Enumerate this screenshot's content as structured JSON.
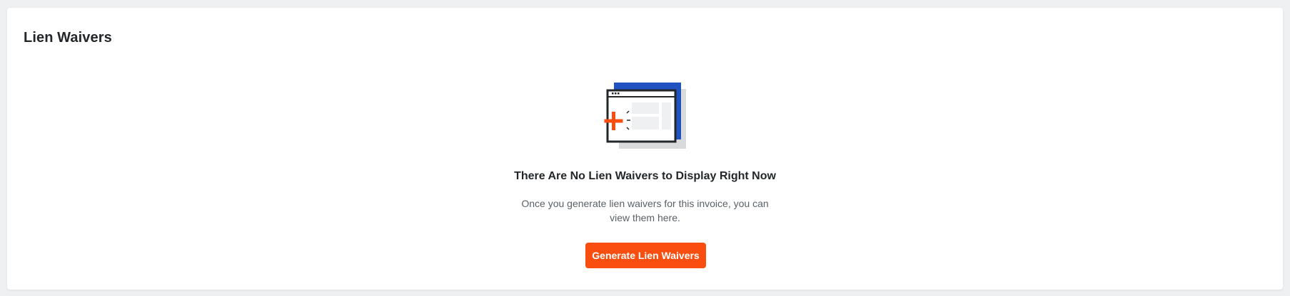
{
  "card": {
    "title": "Lien Waivers"
  },
  "empty_state": {
    "icon": "empty-document-add-icon",
    "heading": "There Are No Lien Waivers to Display Right Now",
    "description": "Once you generate lien waivers for this invoice, you can view them here.",
    "button_label": "Generate Lien Waivers"
  },
  "colors": {
    "accent": "#f94e0f",
    "illustration_blue": "#2052c0",
    "heading_text": "#232729",
    "body_text": "#5a6166"
  }
}
